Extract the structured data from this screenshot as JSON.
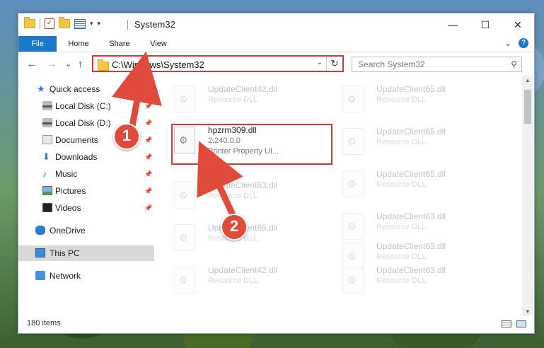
{
  "window": {
    "title": "System32",
    "controls": {
      "minimize": "—",
      "maximize": "☐",
      "close": "✕"
    }
  },
  "quick_access_toolbar": {
    "check_glyph": "✓",
    "dropdown_glyph": "▾",
    "customize_glyph": "▾"
  },
  "ribbon": {
    "tabs": [
      "File",
      "Home",
      "Share",
      "View"
    ],
    "expand_glyph": "⌄",
    "help_glyph": "?"
  },
  "navigation": {
    "back_glyph": "←",
    "forward_glyph": "→",
    "recent_glyph": "⌄",
    "up_glyph": "↑",
    "address": "C:\\Windows\\System32",
    "address_dropdown_glyph": "⌄",
    "refresh_glyph": "↻",
    "search_placeholder": "Search System32",
    "search_glyph": "⚲"
  },
  "sidebar": {
    "items": [
      {
        "label": "Quick access",
        "icon": "quick-access-star-icon",
        "glyph": "★",
        "pinned": false,
        "level": 0
      },
      {
        "label": "Local Disk (C:)",
        "icon": "drive-icon",
        "pinned": true,
        "level": 1
      },
      {
        "label": "Local Disk (D:)",
        "icon": "drive-icon",
        "pinned": true,
        "level": 1
      },
      {
        "label": "Documents",
        "icon": "documents-icon",
        "pinned": true,
        "level": 1
      },
      {
        "label": "Downloads",
        "icon": "downloads-icon",
        "glyph": "⬇",
        "pinned": true,
        "level": 1
      },
      {
        "label": "Music",
        "icon": "music-icon",
        "glyph": "♪",
        "pinned": true,
        "level": 1
      },
      {
        "label": "Pictures",
        "icon": "pictures-icon",
        "pinned": true,
        "level": 1
      },
      {
        "label": "Videos",
        "icon": "videos-icon",
        "pinned": true,
        "level": 1
      },
      {
        "label": "OneDrive",
        "icon": "onedrive-cloud-icon",
        "pinned": false,
        "level": 0
      },
      {
        "label": "This PC",
        "icon": "this-pc-icon",
        "pinned": false,
        "level": 0,
        "selected": true
      },
      {
        "label": "Network",
        "icon": "network-icon",
        "pinned": false,
        "level": 0
      }
    ],
    "pin_glyph": "📌"
  },
  "files": {
    "gear_glyph": "⚙",
    "left_column": [
      {
        "name": "UpdateClient42.dll",
        "type": "Resource DLL",
        "faded": true
      },
      {
        "name": "hpzrm309.dll",
        "version": "2.240.0.0",
        "description": "Printer Property UI...",
        "faded": false,
        "highlighted": true
      },
      {
        "name": "UpdateClient63.dll",
        "type": "Resource DLL",
        "faded": true
      },
      {
        "name": "UpdateClient65.dll",
        "type": "Resource DLL",
        "faded": true
      },
      {
        "name": "UpdateClient42.dll",
        "type": "Resource DLL",
        "faded": true
      }
    ],
    "right_column": [
      {
        "name": "UpdateClient65.dll",
        "type": "Resource DLL",
        "faded": true
      },
      {
        "name": "UpdateClient65.dll",
        "type": "Resource DLL",
        "faded": true
      },
      {
        "name": "UpdateClient65.dll",
        "type": "Resource DLL",
        "faded": true
      },
      {
        "name": "UpdateClient63.dll",
        "type": "Resource DLL",
        "faded": true
      },
      {
        "name": "UpdateClient63.dll",
        "type": "Resource DLL",
        "faded": true
      },
      {
        "name": "UpdateClient63.dll",
        "type": "Resource DLL",
        "faded": true
      }
    ]
  },
  "scrollbar": {
    "up_glyph": "▲",
    "down_glyph": "▼"
  },
  "status": {
    "item_count": "180 items"
  },
  "annotations": [
    {
      "number": "1",
      "color": "#e04a3a"
    },
    {
      "number": "2",
      "color": "#e04a3a"
    }
  ]
}
